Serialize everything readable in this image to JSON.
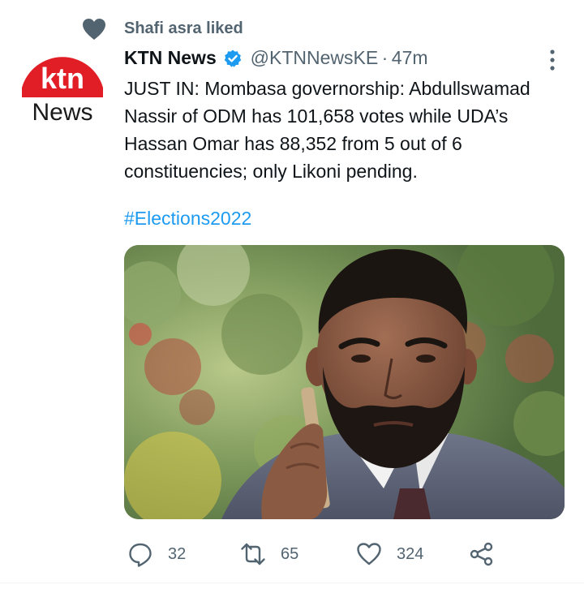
{
  "social_context": {
    "text": "Shafi asra liked",
    "icon": "heart-icon"
  },
  "tweet": {
    "author": {
      "name": "KTN News",
      "handle": "@KTNNewsKE",
      "verified": true,
      "avatar": {
        "logo_top": "ktn",
        "logo_bottom": "News",
        "brand_color": "#e11d26"
      }
    },
    "separator": "·",
    "time": "47m",
    "text_lines": [
      "JUST IN: Mombasa governorship: Abdullswamad",
      "Nassir of ODM has 101,658 votes while UDA’s",
      "Hassan Omar has 88,352 from 5 out of 6",
      "constituencies; only Likoni pending."
    ],
    "hashtag": "#Elections2022",
    "media": {
      "kind": "photo",
      "subject": "man-on-phone"
    },
    "actions": {
      "reply": {
        "icon": "reply-icon",
        "count": "32"
      },
      "retweet": {
        "icon": "retweet-icon",
        "count": "65"
      },
      "like": {
        "icon": "heart-outline-icon",
        "count": "324"
      },
      "share": {
        "icon": "share-icon"
      }
    }
  },
  "colors": {
    "accent": "#1d9bf0",
    "muted": "#536471",
    "text": "#0f1419",
    "verified": "#1d9bf0"
  }
}
